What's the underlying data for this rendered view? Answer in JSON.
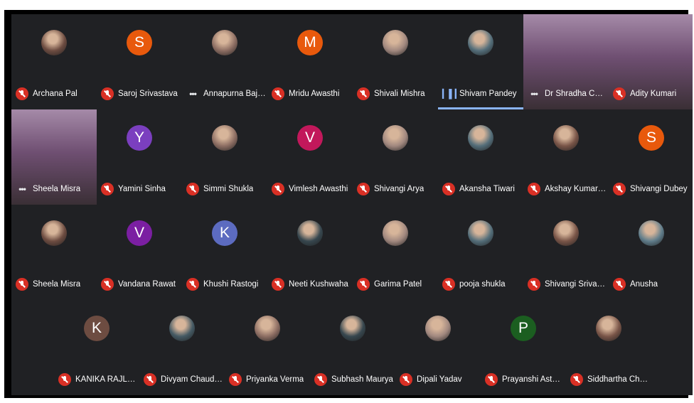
{
  "colors": {
    "meeting_background": "#202124",
    "muted_mic": "#d93025",
    "active_speaker": "#8ab4f8"
  },
  "participants": [
    {
      "name": "Archana Pal",
      "status": "muted",
      "avatar": "photo"
    },
    {
      "name": "Saroj Srivastava",
      "status": "muted",
      "avatar": "letter",
      "initial": "S",
      "color": "#e8590c"
    },
    {
      "name": "Annapurna Bajpai",
      "status": "more-options",
      "avatar": "photo"
    },
    {
      "name": "Mridu Awasthi",
      "status": "muted",
      "avatar": "letter",
      "initial": "M",
      "color": "#e8590c"
    },
    {
      "name": "Shivali Mishra",
      "status": "muted",
      "avatar": "photo"
    },
    {
      "name": "Shivam Pandey",
      "status": "speaking",
      "avatar": "photo",
      "active": true
    },
    {
      "name": "Dr Shradha Chan...",
      "status": "more-options",
      "avatar": "video"
    },
    {
      "name": "Adity Kumari",
      "status": "muted",
      "avatar": "video"
    },
    {
      "name": "Sheela Misra",
      "status": "more-options",
      "avatar": "video"
    },
    {
      "name": "Yamini Sinha",
      "status": "muted",
      "avatar": "letter",
      "initial": "Y",
      "color": "#7b3fbf"
    },
    {
      "name": "Simmi Shukla",
      "status": "muted",
      "avatar": "photo"
    },
    {
      "name": "Vimlesh Awasthi",
      "status": "muted",
      "avatar": "letter",
      "initial": "V",
      "color": "#c2185b"
    },
    {
      "name": "Shivangi Arya",
      "status": "muted",
      "avatar": "photo"
    },
    {
      "name": "Akansha Tiwari",
      "status": "muted",
      "avatar": "photo"
    },
    {
      "name": "Akshay Kumar Si...",
      "status": "muted",
      "avatar": "photo"
    },
    {
      "name": "Shivangi Dubey",
      "status": "muted",
      "avatar": "letter",
      "initial": "S",
      "color": "#e8590c"
    },
    {
      "name": "Sheela Misra",
      "status": "muted",
      "avatar": "photo"
    },
    {
      "name": "Vandana Rawat",
      "status": "muted",
      "avatar": "letter",
      "initial": "V",
      "color": "#7b1fa2"
    },
    {
      "name": "Khushi Rastogi",
      "status": "muted",
      "avatar": "letter",
      "initial": "K",
      "color": "#5c6bc0"
    },
    {
      "name": "Neeti Kushwaha",
      "status": "muted",
      "avatar": "photo"
    },
    {
      "name": "Garima Patel",
      "status": "muted",
      "avatar": "photo"
    },
    {
      "name": "pooja shukla",
      "status": "muted",
      "avatar": "photo"
    },
    {
      "name": "Shivangi Srivasta...",
      "status": "muted",
      "avatar": "photo"
    },
    {
      "name": "Anusha",
      "status": "muted",
      "avatar": "photo"
    },
    {
      "name": "KANIKA RAJLANI",
      "status": "muted",
      "avatar": "letter",
      "initial": "K",
      "color": "#6d4c41"
    },
    {
      "name": "Divyam Chaudhary",
      "status": "muted",
      "avatar": "photo"
    },
    {
      "name": "Priyanka Verma",
      "status": "muted",
      "avatar": "photo"
    },
    {
      "name": "Subhash Maurya",
      "status": "muted",
      "avatar": "photo"
    },
    {
      "name": "Dipali Yadav",
      "status": "muted",
      "avatar": "photo"
    },
    {
      "name": "Prayanshi Asthana",
      "status": "muted",
      "avatar": "letter",
      "initial": "P",
      "color": "#1b5e20"
    },
    {
      "name": "Siddhartha Chatu...",
      "status": "muted",
      "avatar": "photo"
    }
  ]
}
